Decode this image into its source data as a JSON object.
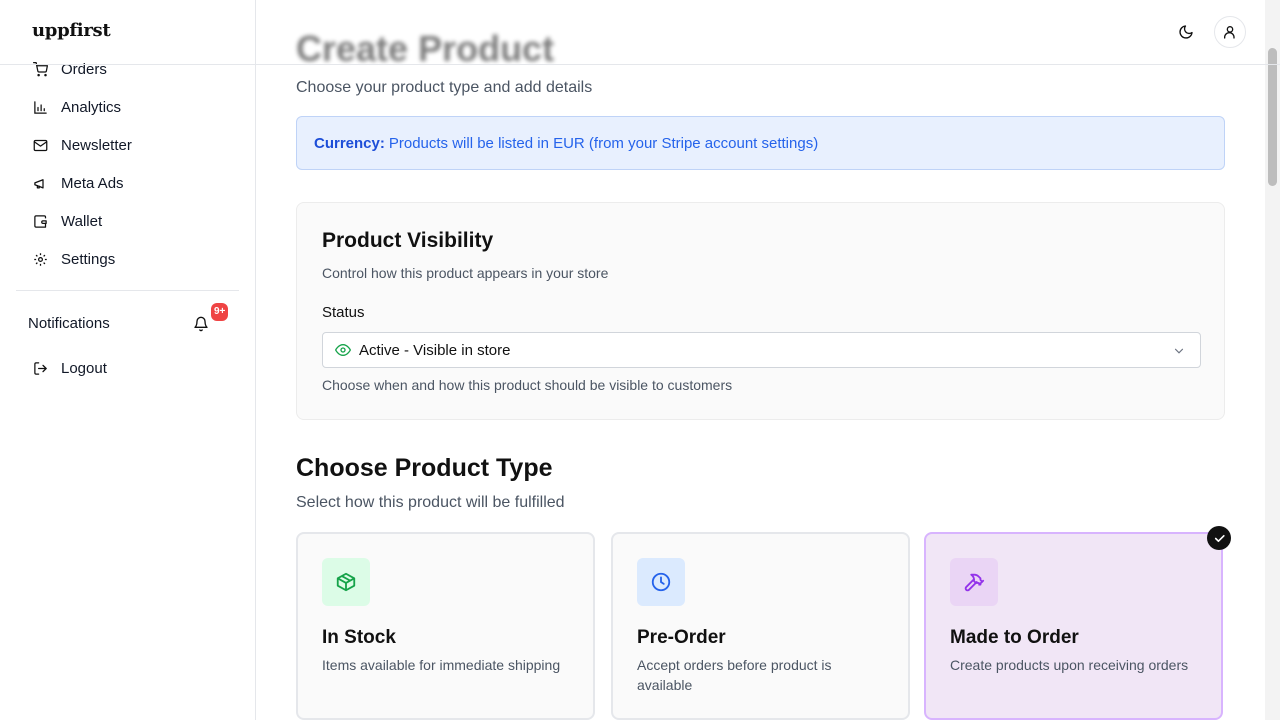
{
  "brand": {
    "logo_text": "uppfirst"
  },
  "header": {
    "theme_toggle_icon": "moon-icon",
    "account_icon": "user-icon"
  },
  "sidebar": {
    "items": [
      {
        "label": "Orders",
        "icon": "shopping-cart-icon"
      },
      {
        "label": "Analytics",
        "icon": "bar-chart-icon"
      },
      {
        "label": "Newsletter",
        "icon": "mail-icon"
      },
      {
        "label": "Meta Ads",
        "icon": "megaphone-icon"
      },
      {
        "label": "Wallet",
        "icon": "wallet-icon"
      },
      {
        "label": "Settings",
        "icon": "gear-icon"
      }
    ],
    "notifications": {
      "label": "Notifications",
      "badge": "9+"
    },
    "logout": {
      "label": "Logout"
    }
  },
  "page": {
    "title": "Create Product",
    "subtitle": "Choose your product type and add details"
  },
  "currency_notice": {
    "label": "Currency:",
    "text": "Products will be listed in EUR (from your Stripe account settings)"
  },
  "visibility": {
    "title": "Product Visibility",
    "description": "Control how this product appears in your store",
    "status_label": "Status",
    "status_value": "Active - Visible in store",
    "hint": "Choose when and how this product should be visible to customers"
  },
  "product_type": {
    "title": "Choose Product Type",
    "subtitle": "Select how this product will be fulfilled",
    "options": [
      {
        "name": "In Stock",
        "description": "Items available for immediate shipping",
        "icon": "package-icon",
        "selected": false
      },
      {
        "name": "Pre-Order",
        "description": "Accept orders before product is available",
        "icon": "clock-icon",
        "selected": false
      },
      {
        "name": "Made to Order",
        "description": "Create products upon receiving orders",
        "icon": "hammer-icon",
        "selected": true
      }
    ]
  },
  "colors": {
    "accent_blue": "#2563eb",
    "notice_bg": "#e8f0fe",
    "selected_border": "#d8b4fe",
    "selected_bg": "#f1e6f6",
    "badge_red": "#ef4444",
    "status_green": "#16a34a"
  }
}
